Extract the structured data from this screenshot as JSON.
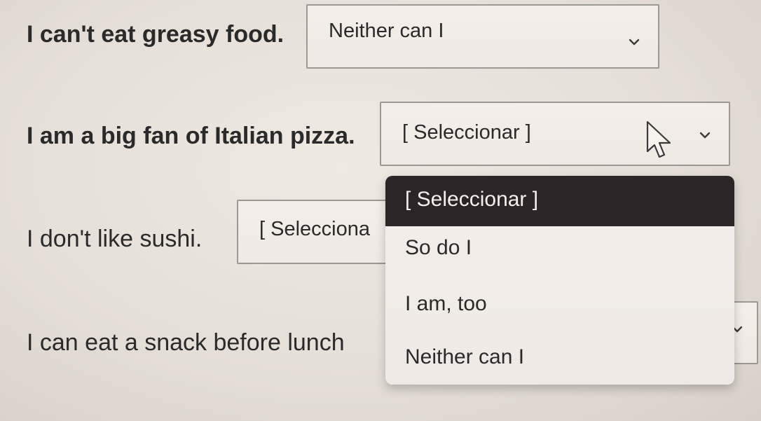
{
  "questions": [
    {
      "prompt": "I can't eat greasy food.",
      "selected": "Neither can I"
    },
    {
      "prompt": "I am a big fan of Italian pizza.",
      "selected": "[ Seleccionar ]"
    },
    {
      "prompt": "I don't like sushi.",
      "selected": "[ Selecciona"
    },
    {
      "prompt": "I can eat a snack before lunch",
      "selected": ""
    }
  ],
  "dropdown": {
    "options": [
      "[ Seleccionar ]",
      "So do I",
      "I am, too",
      "Neither can I"
    ],
    "highlighted_index": 0
  },
  "icons": {
    "chevron": "chevron-down-icon",
    "cursor": "mouse-pointer-icon"
  },
  "colors": {
    "highlight_bg": "#2b2527",
    "border": "#9c9894"
  }
}
